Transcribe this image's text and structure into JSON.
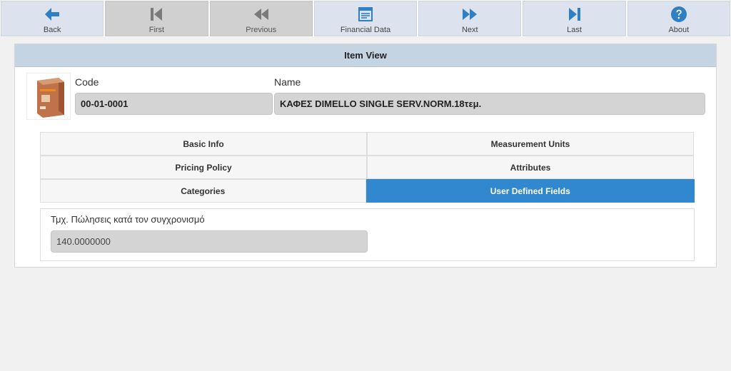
{
  "toolbar": {
    "items": [
      {
        "label": "Back",
        "icon": "arrow-left-icon",
        "enabled": true
      },
      {
        "label": "First",
        "icon": "skip-first-icon",
        "enabled": false
      },
      {
        "label": "Previous",
        "icon": "rewind-icon",
        "enabled": false
      },
      {
        "label": "Financial Data",
        "icon": "financial-data-icon",
        "enabled": true
      },
      {
        "label": "Next",
        "icon": "fast-forward-icon",
        "enabled": true
      },
      {
        "label": "Last",
        "icon": "skip-last-icon",
        "enabled": true
      },
      {
        "label": "About",
        "icon": "question-circle-icon",
        "enabled": true
      }
    ]
  },
  "colors": {
    "accent": "#3288cf",
    "header_bg": "#c5d4e3",
    "icon": "#2f7fc4"
  },
  "panel": {
    "title": "Item View",
    "code_label": "Code",
    "code_value": "00-01-0001",
    "name_label": "Name",
    "name_value": "ΚΑΦΕΣ DIMELLO SINGLE SERV.NORM.18τεμ."
  },
  "tabs": {
    "basic_info": "Basic Info",
    "measurement_units": "Measurement Units",
    "pricing_policy": "Pricing Policy",
    "attributes": "Attributes",
    "categories": "Categories",
    "user_defined_fields": "User Defined Fields",
    "active": "User Defined Fields"
  },
  "udf": {
    "label": "Τμχ. Πώλησεις κατά τον συγχρονισμό",
    "value": "140.0000000"
  }
}
